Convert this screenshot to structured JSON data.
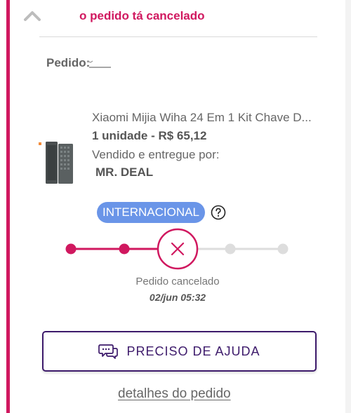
{
  "colors": {
    "brand": "#d0185f",
    "badge": "#6a95e8",
    "help_border": "#3d1a6b",
    "inactive": "#dddddd"
  },
  "header": {
    "collapse_icon": "chevron-up-icon",
    "status_title": "o pedido tá cancelado"
  },
  "order": {
    "label": "Pedido:"
  },
  "product": {
    "title": "Xiaomi Mijia Wiha 24 Em 1 Kit Chave D...",
    "quantity_price": "1 unidade - R$ 65,12",
    "sold_by_label": "Vendido e entregue por:",
    "seller": "MR. DEAL"
  },
  "badge": {
    "label": "INTERNACIONAL",
    "help_icon": "question-circle-icon"
  },
  "tracking": {
    "steps_completed": 2,
    "steps_total": 5,
    "current_state": "cancelled",
    "status_label": "Pedido cancelado",
    "status_date": "02/jun 05:32"
  },
  "actions": {
    "help_button": "PRECISO DE AJUDA",
    "help_icon": "chat-bubbles-icon",
    "details_link": "detalhes do pedido"
  }
}
